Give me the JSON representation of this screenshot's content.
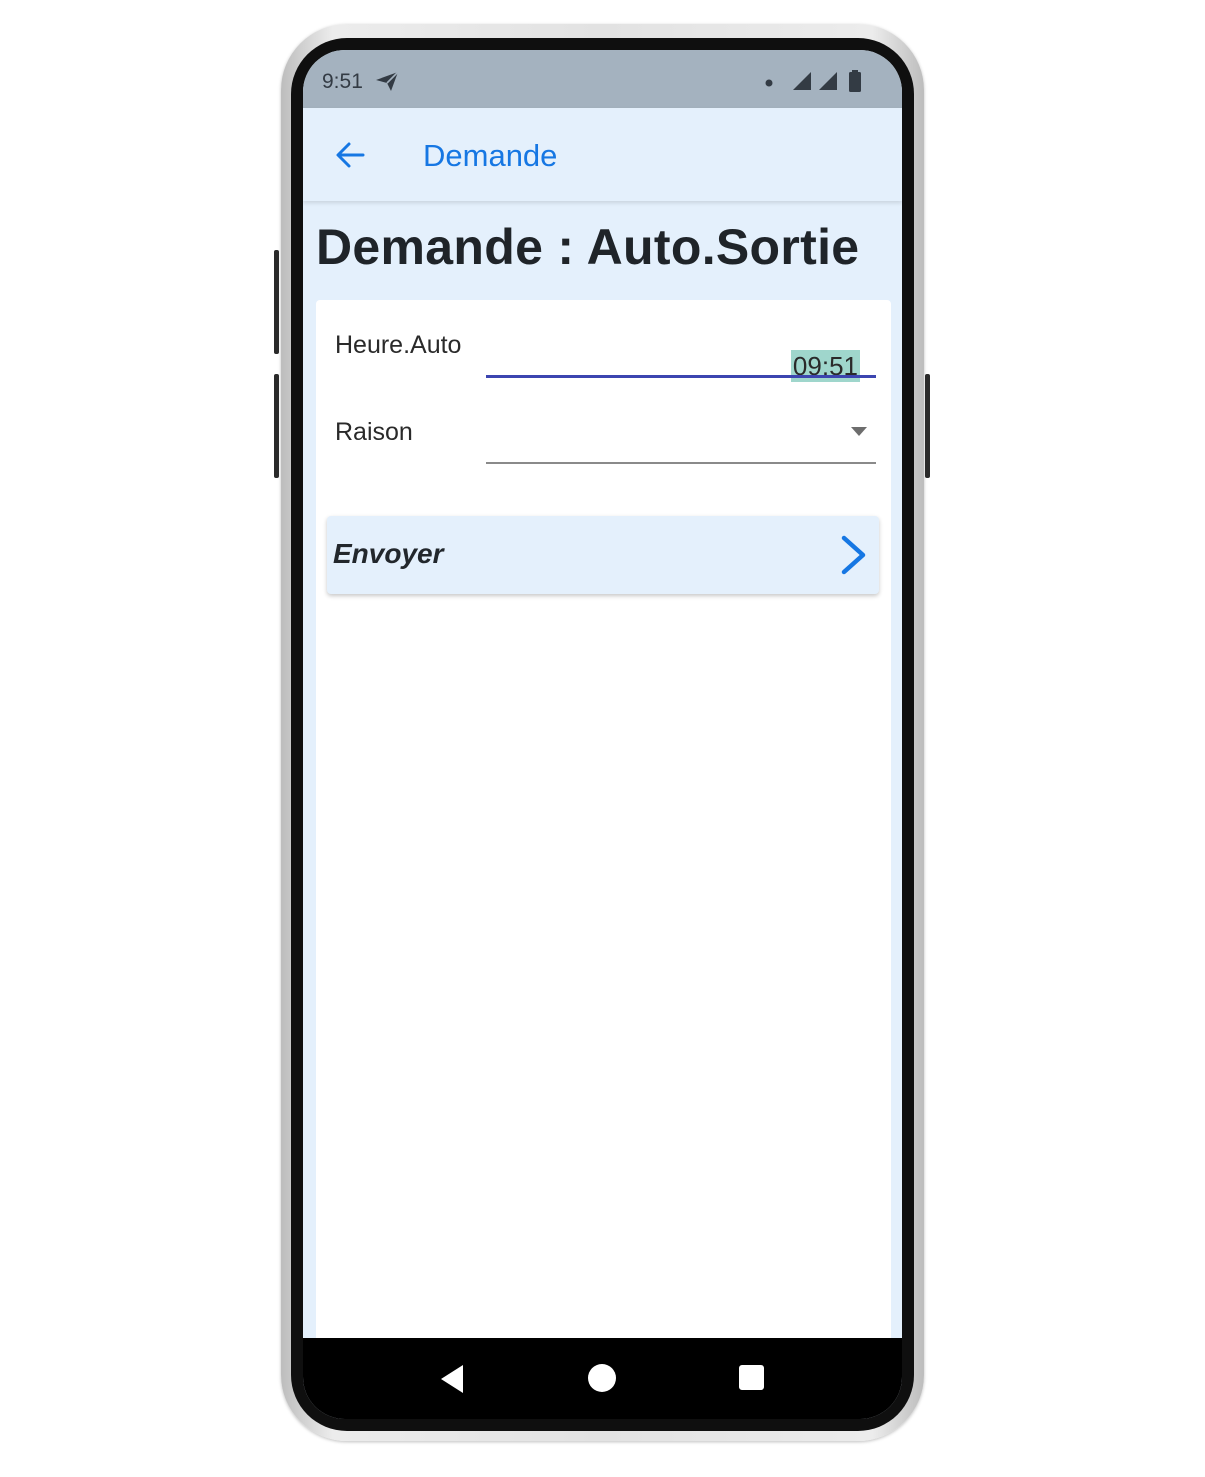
{
  "status_bar": {
    "time": "9:51",
    "icons": [
      "send-icon",
      "notification-dot-icon",
      "signal-icon",
      "signal-icon",
      "battery-icon"
    ]
  },
  "app_bar": {
    "back_icon": "arrow-left-icon",
    "title": "Demande"
  },
  "page": {
    "title": "Demande : Auto.Sortie"
  },
  "form": {
    "heure": {
      "label": "Heure.Auto",
      "value": "09:51"
    },
    "raison": {
      "label": "Raison",
      "value": ""
    },
    "submit": {
      "label": "Envoyer",
      "icon": "chevron-right-icon"
    }
  },
  "nav_bar": {
    "icons": [
      "nav-back-icon",
      "nav-home-icon",
      "nav-recents-icon"
    ]
  },
  "colors": {
    "accent": "#1677e3",
    "app_background": "#e4f0fc",
    "status_bar": "#a4b2bf",
    "active_underline": "#3c45b0",
    "time_highlight": "#9fd6cc"
  }
}
